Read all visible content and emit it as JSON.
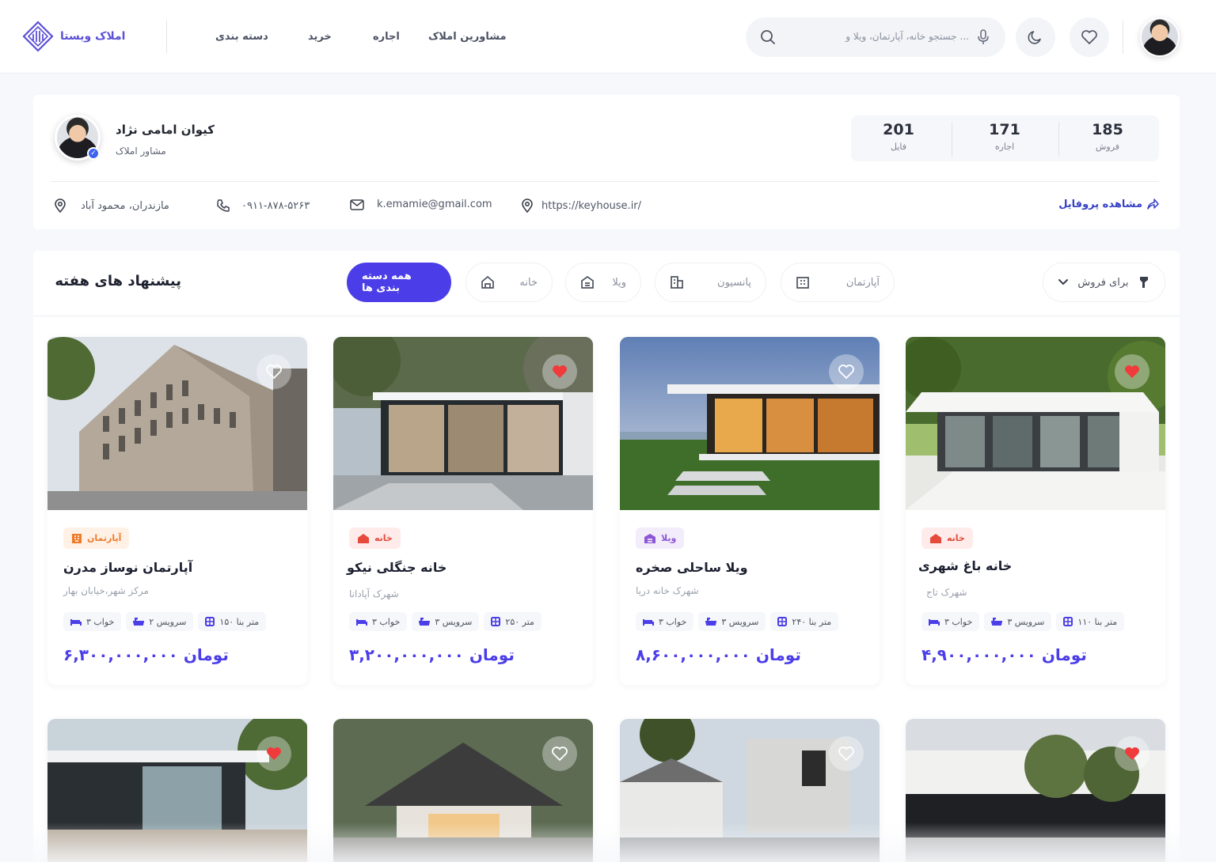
{
  "header": {
    "logo_text": "املاک ویستا",
    "nav": [
      "مشاورین املاک",
      "اجاره",
      "خرید",
      "دسته بندی"
    ],
    "search_placeholder": "جستجو خانه، آپارتمان، ویلا و ..."
  },
  "profile": {
    "name": "کیوان امامی نژاد",
    "role": "مشاور املاک",
    "stats": [
      {
        "value": "185",
        "label": "فروش"
      },
      {
        "value": "171",
        "label": "اجاره"
      },
      {
        "value": "201",
        "label": "فایل"
      }
    ],
    "location": "مازندران، محمود آباد",
    "phone": "۰۹۱۱-۸۷۸-۵۲۶۳",
    "email": "k.emamie@gmail.com",
    "website": "https://keyhouse.ir/",
    "view_profile": "مشاهده پروفایل"
  },
  "listings": {
    "title": "پیشنهاد های هفته",
    "filter_dropdown": "برای فروش",
    "chips": [
      "آپارتمان",
      "پانسیون",
      "ویلا",
      "خانه",
      "همه دسته بندی ها"
    ],
    "cards": [
      {
        "category": "خانه",
        "title": "خانه باغ شهری",
        "location": "شهرک تاج",
        "area": "۱۱۰ متر بنا",
        "bath": "۳ سرویس",
        "bed": "۳ خواب",
        "price": "۴,۹۰۰,۰۰۰,۰۰۰ تومان",
        "liked": true
      },
      {
        "category": "ویلا",
        "title": "ویلا ساحلی صخره",
        "location": "شهرک خانه دریا",
        "area": "۲۴۰ متر بنا",
        "bath": "۳ سرویس",
        "bed": "۳ خواب",
        "price": "۸,۶۰۰,۰۰۰,۰۰۰ تومان",
        "liked": false
      },
      {
        "category": "خانه",
        "title": "خانه جنگلی نیکو",
        "location": "شهرک آپادانا",
        "area": "۲۵۰ متر",
        "bath": "۳ سرویس",
        "bed": "۳ خواب",
        "price": "۳,۲۰۰,۰۰۰,۰۰۰ تومان",
        "liked": true
      },
      {
        "category": "آپارتمان",
        "title": "آپارتمان نوساز مدرن",
        "location": "مرکز شهر،خیابان بهار",
        "area": "۱۵۰ متر بنا",
        "bath": "۲ سرویس",
        "bed": "۳ خواب",
        "price": "۶,۳۰۰,۰۰۰,۰۰۰ تومان",
        "liked": false
      }
    ],
    "second_row_liked": [
      true,
      false,
      false,
      true
    ]
  },
  "colors": {
    "accent": "#4b3ee8",
    "house_badge": "#ffecea",
    "villa_badge": "#f3ecfb",
    "apartment_badge": "#fff1e6",
    "heart_red": "#ef3b3b"
  }
}
